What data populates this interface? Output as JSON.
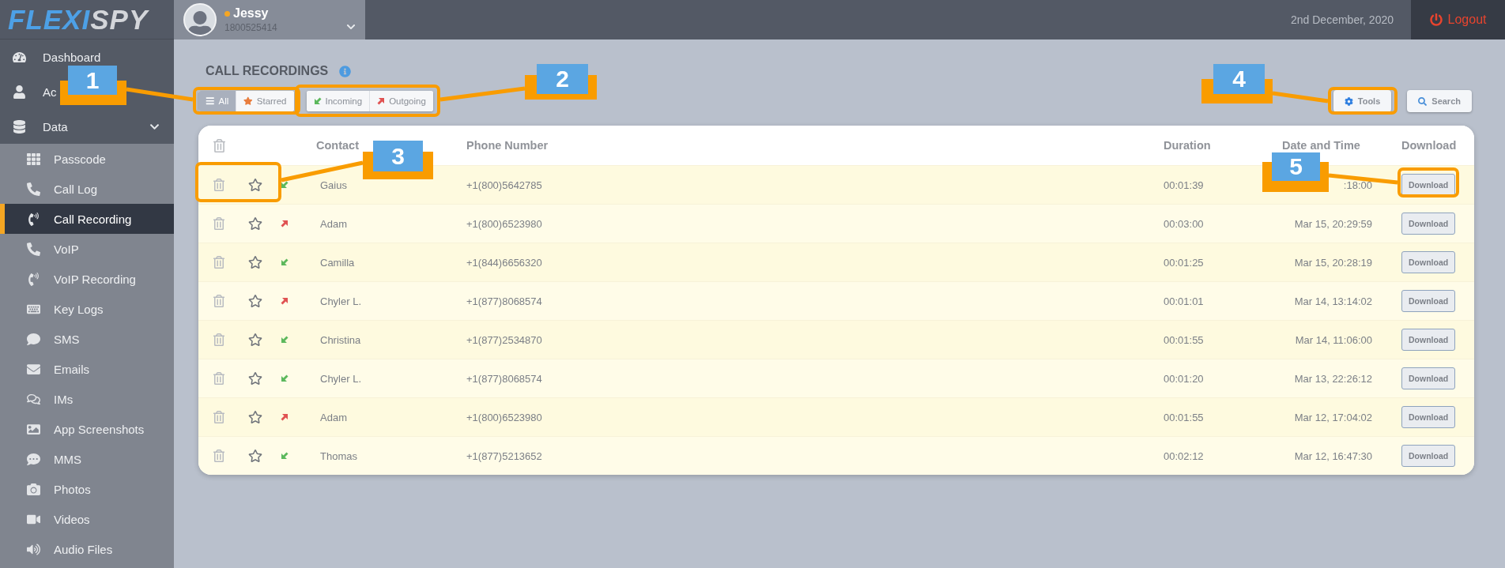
{
  "logo": [
    "FLEXI",
    "SPY"
  ],
  "profile": {
    "name": "Jessy",
    "number": "1800525414",
    "online": true
  },
  "header": {
    "date": "2nd December, 2020",
    "logout": "Logout"
  },
  "sidebar": {
    "items": [
      {
        "label": "Dashboard",
        "selected": false
      },
      {
        "label": "Ac",
        "selected": false
      },
      {
        "label": "Data",
        "selected": false,
        "expanded": true,
        "children": [
          {
            "label": "Passcode",
            "selected": false
          },
          {
            "label": "Call Log",
            "selected": false
          },
          {
            "label": "Call Recording",
            "selected": true
          },
          {
            "label": "VoIP",
            "selected": false
          },
          {
            "label": "VoIP Recording",
            "selected": false
          },
          {
            "label": "Key Logs",
            "selected": false
          },
          {
            "label": "SMS",
            "selected": false
          },
          {
            "label": "Emails",
            "selected": false
          },
          {
            "label": "IMs",
            "selected": false
          },
          {
            "label": "App Screenshots",
            "selected": false
          },
          {
            "label": "MMS",
            "selected": false
          },
          {
            "label": "Photos",
            "selected": false
          },
          {
            "label": "Videos",
            "selected": false
          },
          {
            "label": "Audio Files",
            "selected": false
          }
        ]
      }
    ]
  },
  "page_title": "CALL RECORDINGS",
  "filters": [
    {
      "label": "All",
      "kind": "all",
      "selected": true
    },
    {
      "label": "Starred",
      "kind": "starred",
      "selected": false
    }
  ],
  "direction_filters": [
    {
      "label": "Incoming",
      "kind": "incoming",
      "selected": false
    },
    {
      "label": "Outgoing",
      "kind": "outgoing",
      "selected": false
    }
  ],
  "actions": [
    {
      "label": "Tools",
      "kind": "tools"
    },
    {
      "label": "Search",
      "kind": "search"
    }
  ],
  "table": {
    "columns": [
      "Contact",
      "Phone Number",
      "Duration",
      "Date and Time",
      "Download"
    ],
    "rows": [
      {
        "kind": "incoming",
        "starred": false,
        "contact": "Gaius",
        "phone": "+1(800)5642785",
        "duration": "00:01:39",
        "date": ":18:00",
        "download": "Download"
      },
      {
        "kind": "outgoing",
        "starred": false,
        "contact": "Adam",
        "phone": "+1(800)6523980",
        "duration": "00:03:00",
        "date": "Mar 15, 20:29:59",
        "download": "Download"
      },
      {
        "kind": "incoming",
        "starred": false,
        "contact": "Camilla",
        "phone": "+1(844)6656320",
        "duration": "00:01:25",
        "date": "Mar 15, 20:28:19",
        "download": "Download"
      },
      {
        "kind": "outgoing",
        "starred": false,
        "contact": "Chyler L.",
        "phone": "+1(877)8068574",
        "duration": "00:01:01",
        "date": "Mar 14, 13:14:02",
        "download": "Download"
      },
      {
        "kind": "incoming",
        "starred": false,
        "contact": "Christina",
        "phone": "+1(877)2534870",
        "duration": "00:01:55",
        "date": "Mar 14, 11:06:00",
        "download": "Download"
      },
      {
        "kind": "incoming",
        "starred": false,
        "contact": "Chyler L.",
        "phone": "+1(877)8068574",
        "duration": "00:01:20",
        "date": "Mar 13, 22:26:12",
        "download": "Download"
      },
      {
        "kind": "outgoing",
        "starred": false,
        "contact": "Adam",
        "phone": "+1(800)6523980",
        "duration": "00:01:55",
        "date": "Mar 12, 17:04:02",
        "download": "Download"
      },
      {
        "kind": "incoming",
        "starred": false,
        "contact": "Thomas",
        "phone": "+1(877)5213652",
        "duration": "00:02:12",
        "date": "Mar 12, 16:47:30",
        "download": "Download"
      }
    ]
  },
  "callouts": [
    {
      "number": "1"
    },
    {
      "number": "2"
    },
    {
      "number": "3"
    },
    {
      "number": "4"
    },
    {
      "number": "5"
    }
  ]
}
